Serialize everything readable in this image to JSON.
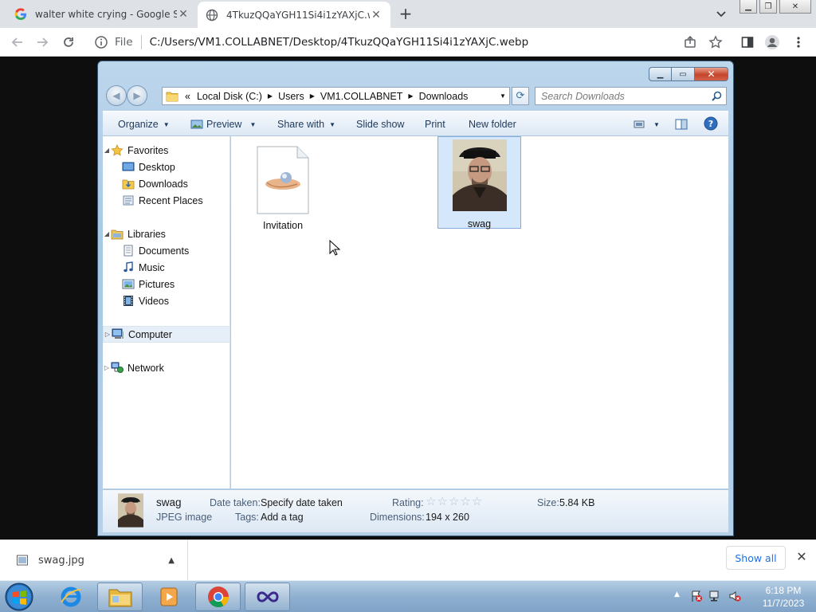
{
  "browser": {
    "tabs": [
      {
        "title": "walter white crying - Google Search",
        "icon": "google-g-icon"
      },
      {
        "title": "4TkuzQQaYGH11Si4i1zYAXjC.webp",
        "icon": "globe-icon"
      }
    ],
    "address": {
      "scheme_label": "File",
      "url": "C:/Users/VM1.COLLABNET/Desktop/4TkuzQQaYGH11Si4i1zYAXjC.webp"
    }
  },
  "explorer": {
    "breadcrumb": [
      "Local Disk (C:)",
      "Users",
      "VM1.COLLABNET",
      "Downloads"
    ],
    "breadcrumb_overflow": "«",
    "search_placeholder": "Search Downloads",
    "commands": {
      "organize": "Organize",
      "preview": "Preview",
      "share_with": "Share with",
      "slide_show": "Slide show",
      "print": "Print",
      "new_folder": "New folder"
    },
    "nav": {
      "favorites": "Favorites",
      "desktop": "Desktop",
      "downloads": "Downloads",
      "recent_places": "Recent Places",
      "libraries": "Libraries",
      "documents": "Documents",
      "music": "Music",
      "pictures": "Pictures",
      "videos": "Videos",
      "computer": "Computer",
      "network": "Network"
    },
    "files": [
      {
        "name": "Invitation",
        "icon": "generic-file-icon",
        "selected": false
      },
      {
        "name": "swag",
        "icon": "photo-thumbnail",
        "selected": true
      }
    ],
    "details": {
      "name": "swag",
      "type": "JPEG image",
      "date_taken_label": "Date taken:",
      "date_taken_value": "Specify date taken",
      "tags_label": "Tags:",
      "tags_value": "Add a tag",
      "rating_label": "Rating:",
      "rating_value": 0,
      "rating_max": 5,
      "dimensions_label": "Dimensions:",
      "dimensions_value": "194 x 260",
      "size_label": "Size:",
      "size_value": "5.84 KB"
    }
  },
  "downloads": {
    "item": "swag.jpg",
    "show_all": "Show all"
  },
  "taskbar": {
    "apps": [
      "ie-icon",
      "explorer-icon",
      "media-player-icon",
      "chrome-icon",
      "visual-studio-icon"
    ],
    "time": "6:18 PM",
    "date": "11/7/2023"
  },
  "colors": {
    "chrome_tabstrip": "#dee1e6",
    "link_blue": "#1a73e8",
    "selection_blue": "#d5e7fb",
    "taskbar_blue": "#8fb0d0"
  }
}
